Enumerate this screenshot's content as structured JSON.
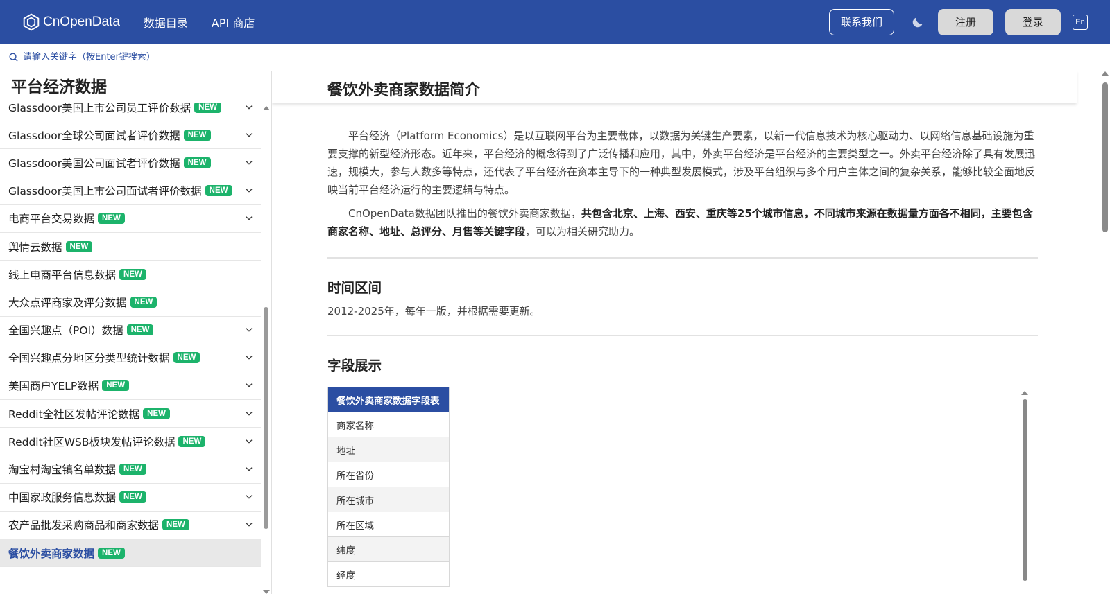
{
  "nav": {
    "logo_text": "CnOpenData",
    "links": [
      "数据目录",
      "API 商店"
    ],
    "contact_label": "联系我们",
    "register_label": "注册",
    "login_label": "登录",
    "lang_label": "En"
  },
  "search": {
    "placeholder": "请输入关键字（按Enter键搜索）"
  },
  "sidebar": {
    "title": "平台经济数据",
    "badge": "NEW",
    "items": [
      {
        "label": "Glassdoor美国上市公司员工评价数据",
        "chevron": true
      },
      {
        "label": "Glassdoor全球公司面试者评价数据",
        "chevron": true
      },
      {
        "label": "Glassdoor美国公司面试者评价数据",
        "chevron": true
      },
      {
        "label": "Glassdoor美国上市公司面试者评价数据",
        "chevron": true
      },
      {
        "label": "电商平台交易数据",
        "chevron": true
      },
      {
        "label": "舆情云数据",
        "chevron": false
      },
      {
        "label": "线上电商平台信息数据",
        "chevron": false
      },
      {
        "label": "大众点评商家及评分数据",
        "chevron": false
      },
      {
        "label": "全国兴趣点（POI）数据",
        "chevron": true
      },
      {
        "label": "全国兴趣点分地区分类型统计数据",
        "chevron": true
      },
      {
        "label": "美国商户YELP数据",
        "chevron": true
      },
      {
        "label": "Reddit全社区发帖评论数据",
        "chevron": true
      },
      {
        "label": "Reddit社区WSB板块发帖评论数据",
        "chevron": true
      },
      {
        "label": "淘宝村淘宝镇名单数据",
        "chevron": true
      },
      {
        "label": "中国家政服务信息数据",
        "chevron": true
      },
      {
        "label": "农产品批发采购商品和商家数据",
        "chevron": true
      },
      {
        "label": "餐饮外卖商家数据",
        "chevron": false,
        "active": true
      }
    ]
  },
  "main": {
    "title": "餐饮外卖商家数据简介",
    "para1": "平台经济（Platform Economics）是以互联网平台为主要载体，以数据为关键生产要素，以新一代信息技术为核心驱动力、以网络信息基础设施为重要支撑的新型经济形态。近年来，平台经济的概念得到了广泛传播和应用，其中，外卖平台经济是平台经济的主要类型之一。外卖平台经济除了具有发展迅速，规模大，参与人数多等特点，还代表了平台经济在资本主导下的一种典型发展模式，涉及平台组织与多个用户主体之间的复杂关系，能够比较全面地反映当前平台经济运行的主要逻辑与特点。",
    "para2_start": "CnOpenData数据团队推出的餐饮外卖商家数据，",
    "para2_bold": "共包含北京、上海、西安、重庆等25个城市信息，不同城市来源在数据量方面各不相同，主要包含商家名称、地址、总评分、月售等关键字段",
    "para2_end": "，可以为相关研究助力。",
    "section_time": "时间区间",
    "time_text": "2012-2025年，每年一版，并根据需要更新。",
    "section_fields": "字段展示",
    "table_header": "餐饮外卖商家数据字段表",
    "table_rows": [
      "商家名称",
      "地址",
      "所在省份",
      "所在城市",
      "所在区域",
      "纬度",
      "经度"
    ]
  }
}
